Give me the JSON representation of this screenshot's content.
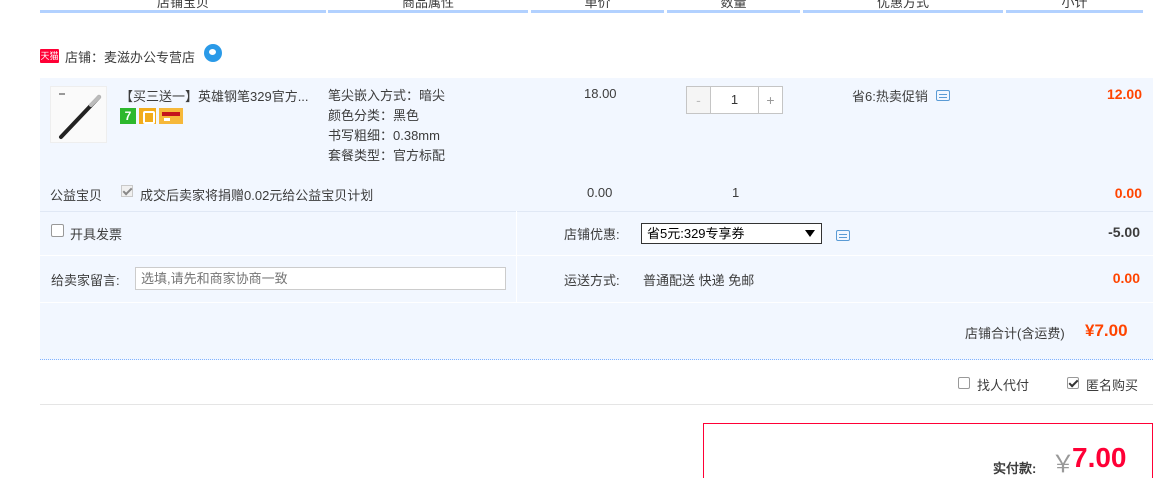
{
  "header": {
    "columns": [
      "店铺宝贝",
      "商品属性",
      "单价",
      "数量",
      "优惠方式",
      "小计"
    ]
  },
  "shop": {
    "badge": "天猫",
    "label": "店铺：麦滋办公专营店"
  },
  "item": {
    "title": "【买三送一】英雄钢笔329官方...",
    "attrs": [
      "笔尖嵌入方式：暗尖",
      "颜色分类：黑色",
      "书写粗细：0.38mm",
      "套餐类型：官方标配"
    ],
    "price": "18.00",
    "quantity": "1",
    "minus": "-",
    "plus": "+",
    "promo": "省6:热卖促销",
    "subtotal": "12.00",
    "badge_7": "7"
  },
  "charity": {
    "label": "公益宝贝",
    "text": "成交后卖家将捐赠0.02元给公益宝贝计划",
    "price": "0.00",
    "quantity": "1",
    "subtotal": "0.00"
  },
  "options": {
    "invoice_label": "开具发票",
    "shop_discount_label": "店铺优惠:",
    "coupon_selected": "省5元:329专享券",
    "discount_value": "-5.00",
    "message_label": "给卖家留言:",
    "message_placeholder": "选填,请先和商家协商一致",
    "shipping_label": "运送方式:",
    "shipping_value": "普通配送 快递 免邮",
    "shipping_cost": "0.00",
    "total_label": "店铺合计(含运费)",
    "total_value": "¥7.00"
  },
  "footer": {
    "agent_label": "找人代付",
    "anon_label": "匿名购买",
    "pay_label": "实付款:",
    "pay_currency": "￥",
    "pay_value": "7.00"
  },
  "colors": {
    "accent": "#ff0036",
    "price_red": "#f40",
    "panel_bg": "#f2f7ff",
    "header_line": "#b2d1ff"
  }
}
